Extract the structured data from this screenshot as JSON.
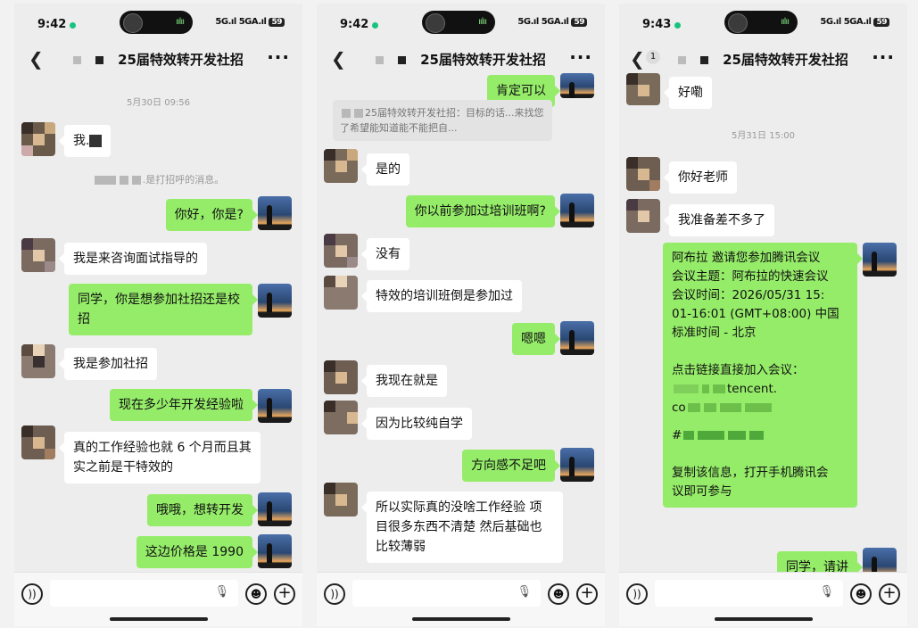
{
  "screens": [
    {
      "status": {
        "time": "9:42",
        "signal": "5G.ıl 5GA.ıl",
        "battery": "59"
      },
      "title": "25届特效转开发社招",
      "timestamp": "5月30日 09:56",
      "system_note": ".是打招呼的消息。",
      "messages": [
        {
          "side": "in",
          "text": "我."
        },
        {
          "side": "out",
          "text": "你好，你是?"
        },
        {
          "side": "in",
          "text": "我是来咨询面试指导的"
        },
        {
          "side": "out",
          "text": "同学，你是想参加社招还是校招"
        },
        {
          "side": "in",
          "text": "我是参加社招"
        },
        {
          "side": "out",
          "text": "现在多少年开发经验啦"
        },
        {
          "side": "in",
          "text": "真的工作经验也就 6 个月而且其实之前是干特效的"
        },
        {
          "side": "out",
          "text": "哦哦，想转开发"
        },
        {
          "side": "out",
          "text": "这边价格是 1990"
        }
      ]
    },
    {
      "status": {
        "time": "9:42",
        "signal": "5G.ıl 5GA.ıl",
        "battery": "59"
      },
      "title": "25届特效转开发社招",
      "quote": "25届特效转开发社招：目标的话...来找您了希望能知道能不能把自...",
      "messages": [
        {
          "side": "out",
          "text": "肯定可以"
        },
        {
          "side": "in",
          "text": "是的"
        },
        {
          "side": "out",
          "text": "你以前参加过培训班啊?"
        },
        {
          "side": "in",
          "text": "没有"
        },
        {
          "side": "in",
          "text": "特效的培训班倒是参加过"
        },
        {
          "side": "out",
          "text": "嗯嗯"
        },
        {
          "side": "in",
          "text": "我现在就是"
        },
        {
          "side": "in",
          "text": "因为比较纯自学"
        },
        {
          "side": "out",
          "text": "方向感不足吧"
        },
        {
          "side": "in",
          "text": "所以实际真的没啥工作经验 项目很多东西不清楚 然后基础也比较薄弱"
        }
      ]
    },
    {
      "status": {
        "time": "9:43",
        "signal": "5G.ıl 5GA.ıl",
        "battery": "59"
      },
      "title": "25届特效转开发社招",
      "unread": "1",
      "timestamp": "5月31日 15:00",
      "messages": [
        {
          "side": "in",
          "text": "好嘞"
        },
        {
          "side": "in",
          "text": "你好老师"
        },
        {
          "side": "in",
          "text": "我准备差不多了"
        },
        {
          "side": "out",
          "lines": [
            "阿布拉 邀请您参加腾讯会议",
            "会议主题：阿布拉的快速会议",
            "会议时间：2026/05/31 15:",
            "01-16:01 (GMT+08:00) 中国",
            "标准时间 - 北京",
            "",
            "点击链接直接加入会议：",
            "tencent.",
            "co",
            "#",
            "",
            "复制该信息，打开手机腾讯会",
            "议即可参与"
          ]
        },
        {
          "side": "out",
          "text": "同学，请讲"
        }
      ]
    }
  ],
  "colors": {
    "bubble_out": "#95ec69",
    "bubble_in": "#ffffff",
    "background": "#ededed"
  },
  "icons": [
    "back-icon",
    "more-icon",
    "voice-icon",
    "mic-icon",
    "emoji-icon",
    "plus-icon"
  ]
}
